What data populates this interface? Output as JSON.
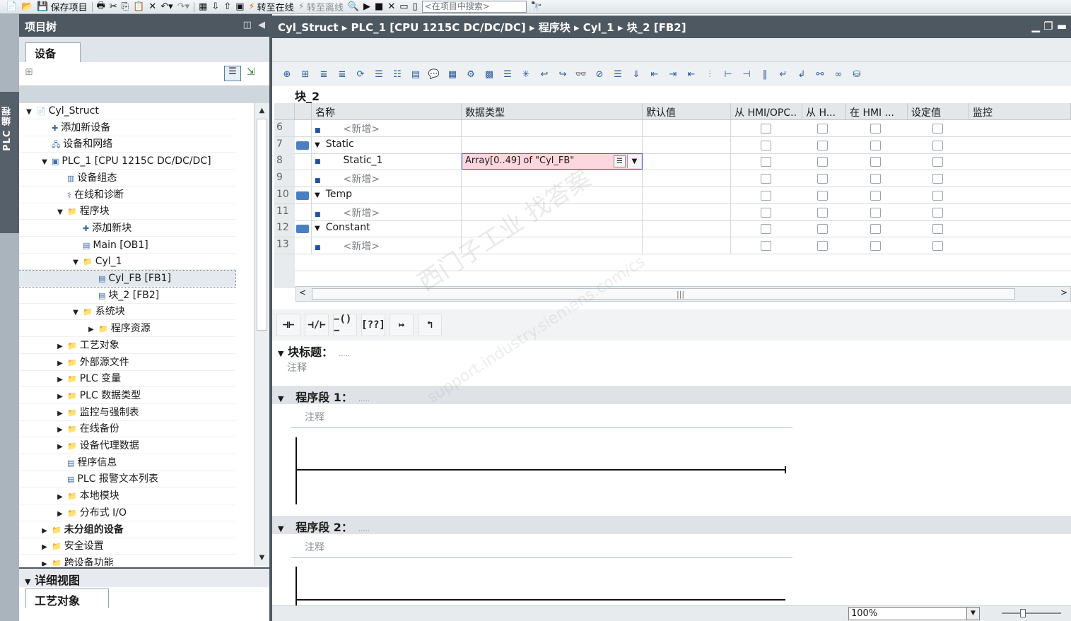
{
  "toolbar": {
    "save_project": "保存项目",
    "go_online": "转至在线",
    "go_offline": "转至离线",
    "search_placeholder": "<在项目中搜索>"
  },
  "side_strip": {
    "label": "PLC 编程"
  },
  "project_tree": {
    "title": "项目树",
    "tab_devices": "设备",
    "items": [
      {
        "label": "Cyl_Struct",
        "level": 0,
        "arrow": "down"
      },
      {
        "label": "添加新设备",
        "level": 1,
        "arrow": ""
      },
      {
        "label": "设备和网络",
        "level": 1,
        "arrow": ""
      },
      {
        "label": "PLC_1 [CPU 1215C DC/DC/DC]",
        "level": 1,
        "arrow": "down"
      },
      {
        "label": "设备组态",
        "level": 2,
        "arrow": ""
      },
      {
        "label": "在线和诊断",
        "level": 2,
        "arrow": ""
      },
      {
        "label": "程序块",
        "level": 2,
        "arrow": "down"
      },
      {
        "label": "添加新块",
        "level": 3,
        "arrow": ""
      },
      {
        "label": "Main [OB1]",
        "level": 3,
        "arrow": ""
      },
      {
        "label": "Cyl_1",
        "level": 3,
        "arrow": "down"
      },
      {
        "label": "Cyl_FB [FB1]",
        "level": 4,
        "arrow": ""
      },
      {
        "label": "块_2 [FB2]",
        "level": 4,
        "arrow": ""
      },
      {
        "label": "系统块",
        "level": 3,
        "arrow": "down"
      },
      {
        "label": "程序资源",
        "level": 4,
        "arrow": "right"
      },
      {
        "label": "工艺对象",
        "level": 2,
        "arrow": "right"
      },
      {
        "label": "外部源文件",
        "level": 2,
        "arrow": "right"
      },
      {
        "label": "PLC 变量",
        "level": 2,
        "arrow": "right"
      },
      {
        "label": "PLC 数据类型",
        "level": 2,
        "arrow": "right"
      },
      {
        "label": "监控与强制表",
        "level": 2,
        "arrow": "right"
      },
      {
        "label": "在线备份",
        "level": 2,
        "arrow": "right"
      },
      {
        "label": "设备代理数据",
        "level": 2,
        "arrow": "right"
      },
      {
        "label": "程序信息",
        "level": 2,
        "arrow": ""
      },
      {
        "label": "PLC 报警文本列表",
        "level": 2,
        "arrow": ""
      },
      {
        "label": "本地模块",
        "level": 2,
        "arrow": "right"
      },
      {
        "label": "分布式 I/O",
        "level": 2,
        "arrow": "right"
      },
      {
        "label": "未分组的设备",
        "level": 1,
        "arrow": "right",
        "bold": true
      },
      {
        "label": "安全设置",
        "level": 1,
        "arrow": "right"
      },
      {
        "label": "跨设备功能",
        "level": 1,
        "arrow": "right"
      }
    ]
  },
  "detail_view": {
    "title": "详细视图",
    "tab": "工艺对象"
  },
  "editor": {
    "breadcrumb": [
      "Cyl_Struct",
      "PLC_1 [CPU 1215C DC/DC/DC]",
      "程序块",
      "Cyl_1",
      "块_2 [FB2]"
    ],
    "block_title": "块_2",
    "columns": [
      "名称",
      "数据类型",
      "默认值",
      "从 HMI/OPC..",
      "从 H...",
      "在 HMI ...",
      "设定值",
      "监控"
    ],
    "rows": [
      {
        "num": "6",
        "name": "<新增>",
        "type": "",
        "section": false,
        "indent": true
      },
      {
        "num": "7",
        "name": "Static",
        "type": "",
        "section": true,
        "indent": false
      },
      {
        "num": "8",
        "name": "Static_1",
        "type": "Array[0..49] of \"Cyl_FB\"",
        "section": false,
        "indent": true,
        "editing": true
      },
      {
        "num": "9",
        "name": "<新增>",
        "type": "",
        "section": false,
        "indent": true
      },
      {
        "num": "10",
        "name": "Temp",
        "type": "",
        "section": true,
        "indent": false
      },
      {
        "num": "11",
        "name": "<新增>",
        "type": "",
        "section": false,
        "indent": true
      },
      {
        "num": "12",
        "name": "Constant",
        "type": "",
        "section": true,
        "indent": false
      },
      {
        "num": "13",
        "name": "<新增>",
        "type": "",
        "section": false,
        "indent": true
      }
    ],
    "block_heading": "块标题：",
    "comment": "注释",
    "network1": "程序段 1：",
    "network2": "程序段 2：",
    "zoom": "100%"
  },
  "watermark": {
    "line1": "西门子工业 找答案",
    "line2": "support.industry.siemens.com/cs"
  }
}
